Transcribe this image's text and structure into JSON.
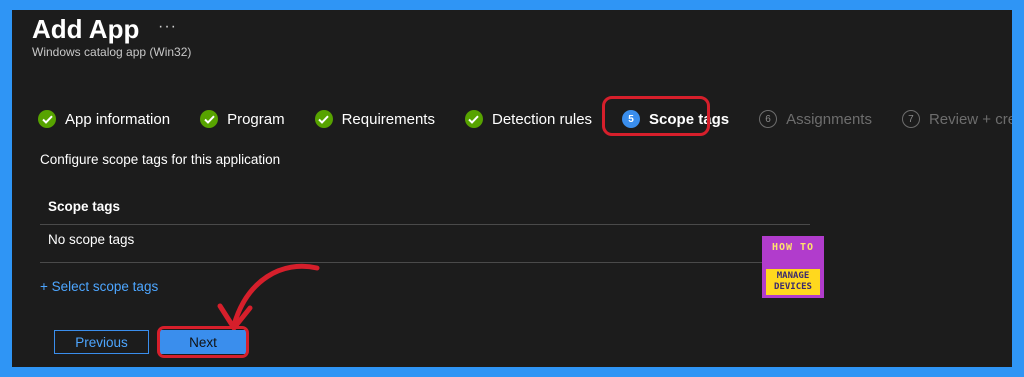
{
  "header": {
    "title": "Add App",
    "more": "···",
    "subtitle": "Windows catalog app (Win32)"
  },
  "steps": [
    {
      "label": "App information",
      "state": "done"
    },
    {
      "label": "Program",
      "state": "done"
    },
    {
      "label": "Requirements",
      "state": "done"
    },
    {
      "label": "Detection rules",
      "state": "done"
    },
    {
      "label": "Scope tags",
      "state": "current",
      "number": "5"
    },
    {
      "label": "Assignments",
      "state": "future",
      "number": "6"
    },
    {
      "label": "Review + create",
      "state": "future",
      "number": "7"
    }
  ],
  "content": {
    "description": "Configure scope tags for this application",
    "table_header": "Scope tags",
    "row_text": "No scope tags",
    "select_link": "+ Select scope tags"
  },
  "logo": {
    "line1": "HOW TO",
    "line2": "MANAGE",
    "line3": "DEVICES"
  },
  "footer": {
    "previous_label": "Previous",
    "next_label": "Next"
  },
  "colors": {
    "page_border": "#2f95f5",
    "background": "#1c1c1c",
    "done_check": "#57a300",
    "accent": "#3a8eed",
    "highlight": "#d61f2b",
    "logo_purple": "#b13ccc",
    "logo_yellow": "#ffd81e"
  }
}
